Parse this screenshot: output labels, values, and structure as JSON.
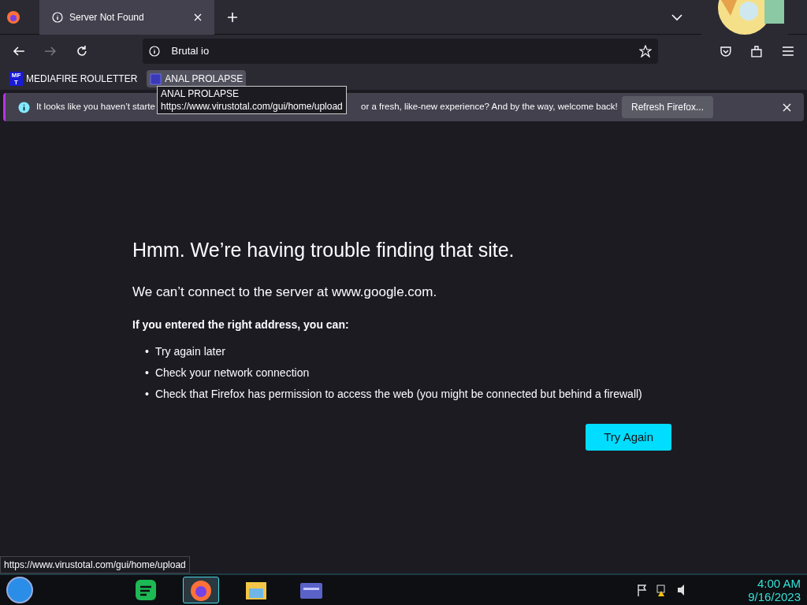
{
  "tab": {
    "title": "Server Not Found",
    "selected": true
  },
  "address": {
    "value": "Brutal io"
  },
  "bookmarks": [
    {
      "label": "MEDIAFIRE ROULETTER",
      "hovered": false,
      "icon_text": "MF T"
    },
    {
      "label": "ANAL PROLAPSE",
      "hovered": true
    }
  ],
  "tooltip": {
    "title": "ANAL PROLAPSE",
    "url": "https://www.virustotal.com/gui/home/upload"
  },
  "notification": {
    "text_start": "It looks like you haven’t starte",
    "text_end": "or a fresh, like-new experience? And by the way, welcome back!",
    "button": "Refresh Firefox..."
  },
  "error": {
    "title": "Hmm. We’re having trouble finding that site.",
    "subtitle": "We can’t connect to the server at www.google.com.",
    "hint": "If you entered the right address, you can:",
    "bullet": "•",
    "items": [
      "Try again later",
      "Check your network connection",
      "Check that Firefox has permission to access the web (you might be connected but behind a firewall)"
    ],
    "button": "Try Again"
  },
  "status_link": "https://www.virustotal.com/gui/home/upload",
  "taskbar": {
    "apps": [
      {
        "kind": "music",
        "active": false
      },
      {
        "kind": "browser",
        "active": true
      },
      {
        "kind": "files",
        "active": false
      },
      {
        "kind": "card",
        "active": false
      }
    ],
    "time": "4:00 AM",
    "date": "9/16/2023"
  }
}
